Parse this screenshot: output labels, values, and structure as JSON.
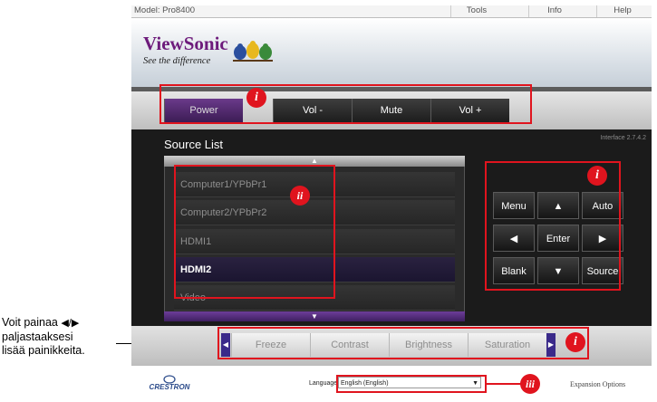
{
  "side_note": {
    "line1_prefix": "Voit painaa ",
    "arrows": "◀/▶",
    "line2": "paljastaaksesi",
    "line3": "lisää painikkeita."
  },
  "topbar": {
    "model": "Model: Pro8400",
    "menus": [
      "Tools",
      "Info",
      "Help"
    ]
  },
  "header": {
    "brand": "ViewSonic",
    "tagline": "See the difference",
    "colors": {
      "brand": "#6d1b7b"
    }
  },
  "control_bar": {
    "buttons": [
      "Power",
      "Vol -",
      "Mute",
      "Vol +"
    ]
  },
  "interface_version": "Interface 2.7.4.2",
  "source_list": {
    "title": "Source List",
    "scroll_up": "▲",
    "scroll_down": "▼",
    "items": [
      "Computer1/YPbPr1",
      "Computer2/YPbPr2",
      "HDMI1",
      "HDMI2",
      "Video"
    ],
    "selected": "HDMI2"
  },
  "nav_pad": {
    "menu": "Menu",
    "up": "▲",
    "auto": "Auto",
    "left": "◀",
    "enter": "Enter",
    "right": "▶",
    "blank": "Blank",
    "down": "▼",
    "source": "Source"
  },
  "function_bar": {
    "left_arrow": "◀",
    "right_arrow": "▶",
    "buttons": [
      "Freeze",
      "Contrast",
      "Brightness",
      "Saturation"
    ]
  },
  "footer": {
    "logo": "CRESTRON",
    "language_label": "Language",
    "language_value": "English (English)",
    "expansion": "Expansion Options"
  },
  "markers": {
    "i": "i",
    "ii": "ii",
    "iii": "iii",
    "color": "#e0141e"
  }
}
